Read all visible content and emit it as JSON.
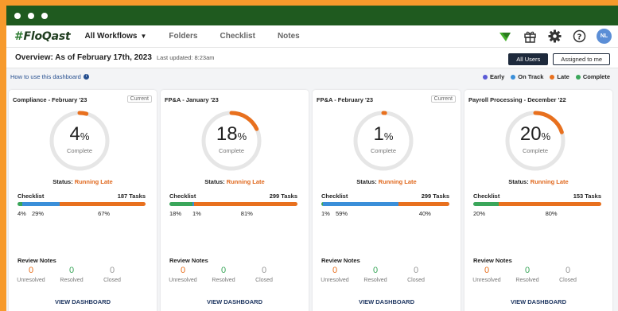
{
  "window": {
    "controls": [
      "close",
      "minimize",
      "maximize"
    ]
  },
  "nav": {
    "logo_hash": "#",
    "logo_text": "FloQast",
    "items": [
      {
        "label": "All Workflows",
        "active": true,
        "dropdown": true
      },
      {
        "label": "Folders"
      },
      {
        "label": "Checklist"
      },
      {
        "label": "Notes"
      }
    ],
    "icons": [
      "flag-icon",
      "gift-icon",
      "gear-icon",
      "help-icon"
    ],
    "avatar": "NL"
  },
  "overview": {
    "title": "Overview: As of February 17th, 2023",
    "updated": "Last updated: 8:23am",
    "btn_all": "All Users",
    "btn_assigned": "Assigned to me"
  },
  "howto": "How to use this dashboard",
  "legend": [
    {
      "label": "Early",
      "color": "#5b5bd6"
    },
    {
      "label": "On Track",
      "color": "#3a8fd9"
    },
    {
      "label": "Late",
      "color": "#e8701e"
    },
    {
      "label": "Complete",
      "color": "#3aa65a"
    }
  ],
  "colors": {
    "early": "#5b5bd6",
    "ontrack": "#3a8fd9",
    "late": "#e8701e",
    "complete": "#3aa65a",
    "track": "#e6e6e6",
    "late_text": "#e0681d"
  },
  "cards": [
    {
      "title": "Compliance - February '23",
      "badge": "Current",
      "pct_num": "4",
      "pct_sign": "%",
      "percent": 4,
      "complete_label": "Complete",
      "status_label": "Status:",
      "status": "Running Late",
      "checklist_label": "Checklist",
      "tasks": "187 Tasks",
      "segments": [
        {
          "type": "complete",
          "pct": 4,
          "label": "4%"
        },
        {
          "type": "ontrack",
          "pct": 29,
          "label": "29%"
        },
        {
          "type": "late",
          "pct": 67,
          "label": "67%"
        }
      ],
      "review_label": "Review Notes",
      "notes": [
        {
          "num": "0",
          "label": "Unresolved",
          "color": "#e8701e"
        },
        {
          "num": "0",
          "label": "Resolved",
          "color": "#3aa65a"
        },
        {
          "num": "0",
          "label": "Closed",
          "color": "#999999"
        }
      ],
      "view": "VIEW DASHBOARD"
    },
    {
      "title": "FP&A - January '23",
      "badge": "",
      "pct_num": "18",
      "pct_sign": "%",
      "percent": 18,
      "complete_label": "Complete",
      "status_label": "Status:",
      "status": "Running Late",
      "checklist_label": "Checklist",
      "tasks": "299 Tasks",
      "segments": [
        {
          "type": "complete",
          "pct": 18,
          "label": "18%"
        },
        {
          "type": "ontrack",
          "pct": 1,
          "label": "1%"
        },
        {
          "type": "late",
          "pct": 81,
          "label": "81%"
        }
      ],
      "review_label": "Review Notes",
      "notes": [
        {
          "num": "0",
          "label": "Unresolved",
          "color": "#e8701e"
        },
        {
          "num": "0",
          "label": "Resolved",
          "color": "#3aa65a"
        },
        {
          "num": "0",
          "label": "Closed",
          "color": "#999999"
        }
      ],
      "view": "VIEW DASHBOARD"
    },
    {
      "title": "FP&A - February '23",
      "badge": "Current",
      "pct_num": "1",
      "pct_sign": "%",
      "percent": 1,
      "complete_label": "Complete",
      "status_label": "Status:",
      "status": "Running Late",
      "checklist_label": "Checklist",
      "tasks": "299 Tasks",
      "segments": [
        {
          "type": "complete",
          "pct": 1,
          "label": "1%"
        },
        {
          "type": "ontrack",
          "pct": 59,
          "label": "59%"
        },
        {
          "type": "late",
          "pct": 40,
          "label": "40%"
        }
      ],
      "review_label": "Review Notes",
      "notes": [
        {
          "num": "0",
          "label": "Unresolved",
          "color": "#e8701e"
        },
        {
          "num": "0",
          "label": "Resolved",
          "color": "#3aa65a"
        },
        {
          "num": "0",
          "label": "Closed",
          "color": "#999999"
        }
      ],
      "view": "VIEW DASHBOARD"
    },
    {
      "title": "Payroll Processing - December '22",
      "badge": "",
      "pct_num": "20",
      "pct_sign": "%",
      "percent": 20,
      "complete_label": "Complete",
      "status_label": "Status:",
      "status": "Running Late",
      "checklist_label": "Checklist",
      "tasks": "153 Tasks",
      "segments": [
        {
          "type": "complete",
          "pct": 20,
          "label": "20%"
        },
        {
          "type": "late",
          "pct": 80,
          "label": "80%"
        }
      ],
      "review_label": "Review Notes",
      "notes": [
        {
          "num": "0",
          "label": "Unresolved",
          "color": "#e8701e"
        },
        {
          "num": "0",
          "label": "Resolved",
          "color": "#3aa65a"
        },
        {
          "num": "0",
          "label": "Closed",
          "color": "#999999"
        }
      ],
      "view": "VIEW DASHBOARD"
    }
  ]
}
